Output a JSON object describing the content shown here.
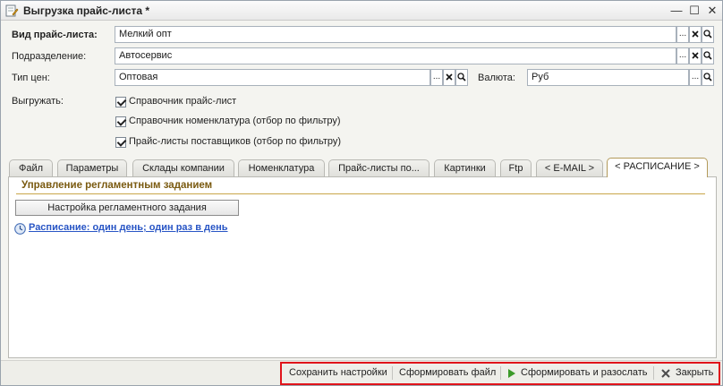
{
  "window": {
    "title": "Выгрузка прайс-листа *",
    "controls": {
      "minimize": "—",
      "maximize": "☐",
      "close": "✕"
    }
  },
  "form": {
    "price_type": {
      "label": "Вид прайс-листа:",
      "value": "Мелкий опт"
    },
    "division": {
      "label": "Подразделение:",
      "value": "Автосервис"
    },
    "price_kind": {
      "label": "Тип цен:",
      "value": "Оптовая"
    },
    "currency": {
      "label": "Валюта:",
      "value": "Руб"
    },
    "export": {
      "label": "Выгружать:",
      "options": [
        {
          "label": "Справочник прайс-лист",
          "checked": true
        },
        {
          "label": "Справочник номенклатура (отбор по фильтру)",
          "checked": true
        },
        {
          "label": "Прайс-листы поставщиков (отбор по фильтру)",
          "checked": true
        }
      ]
    },
    "field_buttons": {
      "select": "...",
      "clear": "✕",
      "search": "🔍"
    }
  },
  "tabs": [
    {
      "label": "Файл"
    },
    {
      "label": "Параметры"
    },
    {
      "label": "Склады компании"
    },
    {
      "label": "Номенклатура"
    },
    {
      "label": "Прайс-листы по..."
    },
    {
      "label": "Картинки"
    },
    {
      "label": "Ftp"
    },
    {
      "label": "< E-MAIL >"
    },
    {
      "label": "< РАСПИСАНИЕ >",
      "active": true
    }
  ],
  "panel": {
    "section_title": "Управление регламентным заданием",
    "settings_button": "Настройка регламентного задания",
    "schedule_link": "Расписание: один день; один раз в день"
  },
  "bottom": {
    "save_settings": "Сохранить настройки",
    "make_file": "Сформировать файл",
    "make_send": "Сформировать и разослать",
    "close": "Закрыть",
    "highlight_color": "#e0141b"
  }
}
